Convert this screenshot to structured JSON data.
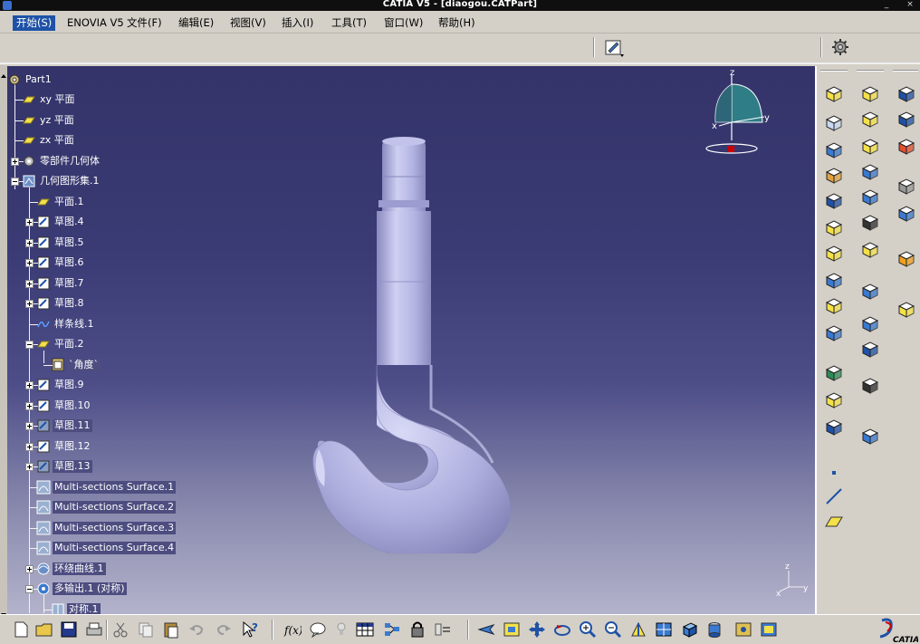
{
  "window": {
    "title": "CATIA V5 - [diaogou.CATPart]",
    "min_glyph": "_",
    "close_glyph": "×"
  },
  "menu": {
    "items": [
      "开始(S)",
      "ENOVIA V5",
      "文件(F)",
      "编辑(E)",
      "视图(V)",
      "插入(I)",
      "工具(T)",
      "窗口(W)",
      "帮助(H)"
    ]
  },
  "tree": {
    "root": "Part1",
    "nodes": [
      {
        "label": "xy 平面",
        "icon": "plane-icon"
      },
      {
        "label": "yz 平面",
        "icon": "plane-icon"
      },
      {
        "label": "zx 平面",
        "icon": "plane-icon"
      },
      {
        "label": "零部件几何体",
        "icon": "part-body-icon"
      },
      {
        "label": "几何图形集.1",
        "icon": "geometrical-set-icon"
      },
      {
        "label": "平面.1",
        "icon": "plane-icon"
      },
      {
        "label": "草图.4",
        "icon": "sketch-icon"
      },
      {
        "label": "草图.5",
        "icon": "sketch-icon"
      },
      {
        "label": "草图.6",
        "icon": "sketch-icon"
      },
      {
        "label": "草图.7",
        "icon": "sketch-icon"
      },
      {
        "label": "草图.8",
        "icon": "sketch-icon"
      },
      {
        "label": "样条线.1",
        "icon": "spline-icon"
      },
      {
        "label": "平面.2",
        "icon": "plane-icon"
      },
      {
        "label": "`角度`",
        "icon": "parameter-icon"
      },
      {
        "label": "草图.9",
        "icon": "sketch-icon"
      },
      {
        "label": "草图.10",
        "icon": "sketch-icon"
      },
      {
        "label": "草图.11",
        "icon": "sketch-hidden-icon"
      },
      {
        "label": "草图.12",
        "icon": "sketch-icon"
      },
      {
        "label": "草图.13",
        "icon": "sketch-hidden-icon"
      },
      {
        "label": "Multi-sections Surface.1",
        "icon": "multi-section-surface-icon"
      },
      {
        "label": "Multi-sections Surface.2",
        "icon": "multi-section-surface-icon"
      },
      {
        "label": "Multi-sections Surface.3",
        "icon": "multi-section-surface-icon"
      },
      {
        "label": "Multi-sections Surface.4",
        "icon": "multi-section-surface-icon"
      },
      {
        "label": "环绕曲线.1",
        "icon": "wrap-curve-icon"
      },
      {
        "label": "多输出.1 (对称)",
        "icon": "multi-output-icon"
      },
      {
        "label": "对称.1",
        "icon": "symmetry-icon"
      }
    ]
  },
  "compass": {
    "x": "x",
    "y": "y",
    "z": "z"
  },
  "axis_triad": {
    "x": "x",
    "y": "y",
    "z": "z"
  },
  "brand": {
    "logo_text": "CATIA"
  },
  "colors": {
    "menu_highlight": "#1f52a6",
    "tree_text": "#ffffff",
    "hook_fill": "#b4b4e6",
    "background_top": "#34346a",
    "background_bottom": "#b3b3cc"
  }
}
